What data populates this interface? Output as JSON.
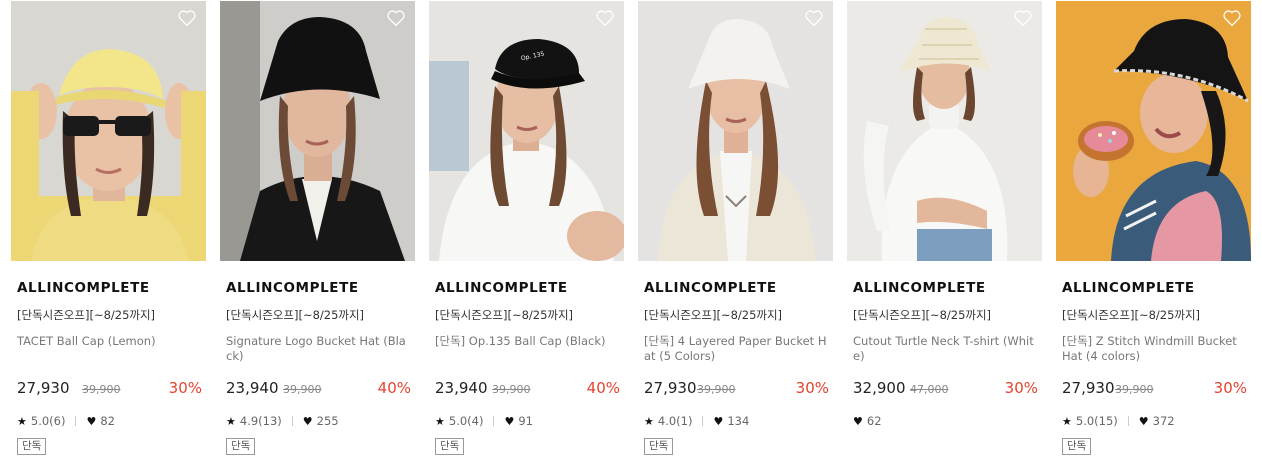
{
  "products": [
    {
      "brand": "ALLINCOMPLETE",
      "promo": "[단독시즌오프][~8/25까지]",
      "name": "TACET Ball Cap (Lemon)",
      "price": "27,930",
      "original_price": "39,900",
      "discount": "30%",
      "rating": "5.0(6)",
      "likes": "82",
      "badge": "단독",
      "image_alt": "model wearing yellow cap and sunglasses",
      "wish_icon": "heart-outline-icon"
    },
    {
      "brand": "ALLINCOMPLETE",
      "promo": "[단독시즌오프][~8/25까지]",
      "name": "Signature Logo Bucket Hat (Black)",
      "price": "23,940",
      "original_price": "39,900",
      "discount": "40%",
      "rating": "4.9(13)",
      "likes": "255",
      "badge": "단독",
      "image_alt": "model wearing black bucket hat and black jacket",
      "wish_icon": "heart-outline-icon"
    },
    {
      "brand": "ALLINCOMPLETE",
      "promo": "[단독시즌오프][~8/25까지]",
      "name": "[단독] Op.135 Ball Cap (Black)",
      "price": "23,940",
      "original_price": "39,900",
      "discount": "40%",
      "rating": "5.0(4)",
      "likes": "91",
      "badge": "단독",
      "image_alt": "model wearing black ball cap and white t-shirt",
      "wish_icon": "heart-outline-icon"
    },
    {
      "brand": "ALLINCOMPLETE",
      "promo": "[단독시즌오프][~8/25까지]",
      "name": "[단독] 4 Layered Paper Bucket Hat (5 Colors)",
      "price": "27,930",
      "original_price": "39,900",
      "discount": "30%",
      "rating": "4.0(1)",
      "likes": "134",
      "badge": "단독",
      "image_alt": "model wearing ivory paper bucket hat and cardigan",
      "wish_icon": "heart-outline-icon"
    },
    {
      "brand": "ALLINCOMPLETE",
      "promo": "[단독시즌오프][~8/25까지]",
      "name": "Cutout Turtle Neck T-shirt (White)",
      "price": "32,900",
      "original_price": "47,000",
      "discount": "30%",
      "rating": "",
      "likes": "62",
      "badge": "",
      "image_alt": "model wearing white cutout turtleneck and crochet hat",
      "wish_icon": "heart-outline-icon"
    },
    {
      "brand": "ALLINCOMPLETE",
      "promo": "[단독시즌오프][~8/25까지]",
      "name": "[단독] Z Stitch Windmill Bucket Hat (4 colors)",
      "price": "27,930",
      "original_price": "39,900",
      "discount": "30%",
      "rating": "5.0(15)",
      "likes": "372",
      "badge": "단독",
      "image_alt": "model wearing black stitched bucket hat eating a donut",
      "wish_icon": "heart-outline-icon"
    }
  ],
  "colors": {
    "discount": "#e5432f",
    "text": "#222222",
    "muted": "#777777"
  }
}
